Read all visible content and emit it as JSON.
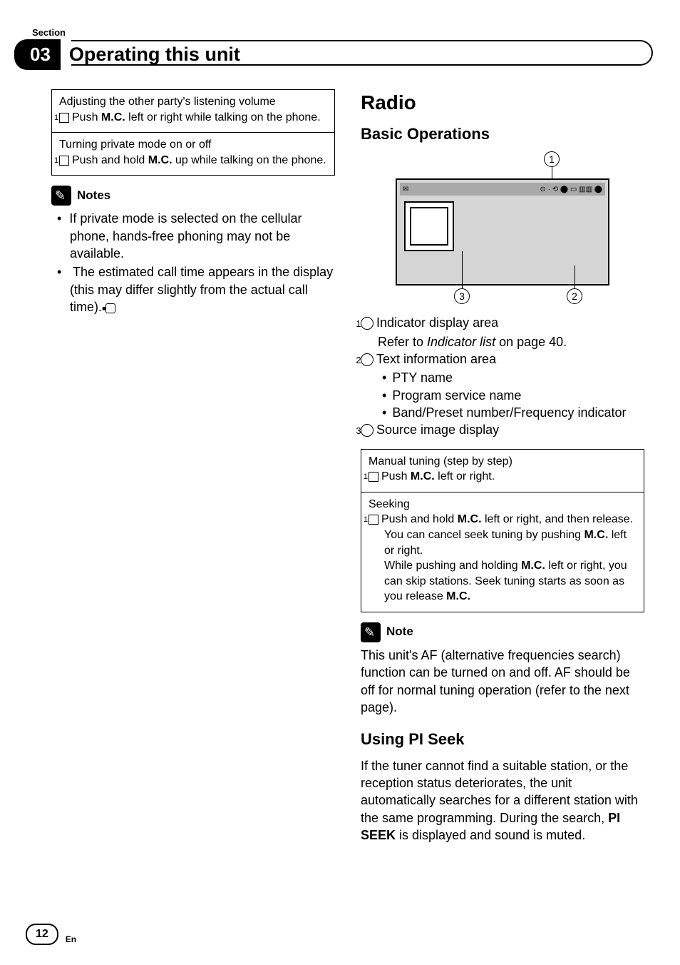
{
  "section_label": "Section",
  "chapter_num": "03",
  "chapter_title": "Operating this unit",
  "left": {
    "box1": {
      "title": "Adjusting the other party's listening volume",
      "step_num": "1",
      "step_a": "Push ",
      "step_bold": "M.C.",
      "step_b": " left or right while talking on the phone."
    },
    "box2": {
      "title": "Turning private mode on or off",
      "step_num": "1",
      "step_a": "Push and hold ",
      "step_bold": "M.C.",
      "step_b": " up while talking on the phone."
    },
    "notes_title": "Notes",
    "note1": "If private mode is selected on the cellular phone, hands-free phoning may not be available.",
    "note2": "The estimated call time appears in the display (this may differ slightly from the actual call time).",
    "end_mark": "■"
  },
  "right": {
    "h2": "Radio",
    "h3a": "Basic Operations",
    "callouts": {
      "c1": "1",
      "c2": "2",
      "c3": "3"
    },
    "ind_left": "✉",
    "ind_right": "⊙ · ⟲ ⬤ ▭ ▥▥ ⬤",
    "legend": {
      "l1_num": "1",
      "l1_label": "Indicator display area",
      "l1_sub_a": "Refer to ",
      "l1_sub_i": "Indicator list",
      "l1_sub_b": " on page 40.",
      "l2_num": "2",
      "l2_label": "Text information area",
      "l2_b1": "PTY name",
      "l2_b2": "Program service name",
      "l2_b3": "Band/Preset number/Frequency indicator",
      "l3_num": "3",
      "l3_label": "Source image display"
    },
    "opbox": {
      "r1_title": "Manual tuning (step by step)",
      "r1_num": "1",
      "r1_a": "Push ",
      "r1_bold": "M.C.",
      "r1_b": " left or right.",
      "r2_title": "Seeking",
      "r2_num": "1",
      "r2_a": "Push and hold ",
      "r2_bold1": "M.C.",
      "r2_b": " left or right, and then release.",
      "r2_c": "You can cancel seek tuning by pushing ",
      "r2_bold2": "M.C.",
      "r2_d": " left or right.",
      "r2_e": "While pushing and holding ",
      "r2_bold3": "M.C.",
      "r2_f": " left or right, you can skip stations. Seek tuning starts as soon as you release ",
      "r2_bold4": "M.C."
    },
    "note_title": "Note",
    "note_text": "This unit's AF (alternative frequencies search) function can be turned on and off. AF should be off for normal tuning operation (refer to the next page).",
    "h3b": "Using PI Seek",
    "pi_a": "If the tuner cannot find a suitable station, or the reception status deteriorates, the unit automatically searches for a different station with the same programming. During the search, ",
    "pi_bold": "PI SEEK",
    "pi_b": " is displayed and sound is muted."
  },
  "page_number": "12",
  "page_lang": "En"
}
